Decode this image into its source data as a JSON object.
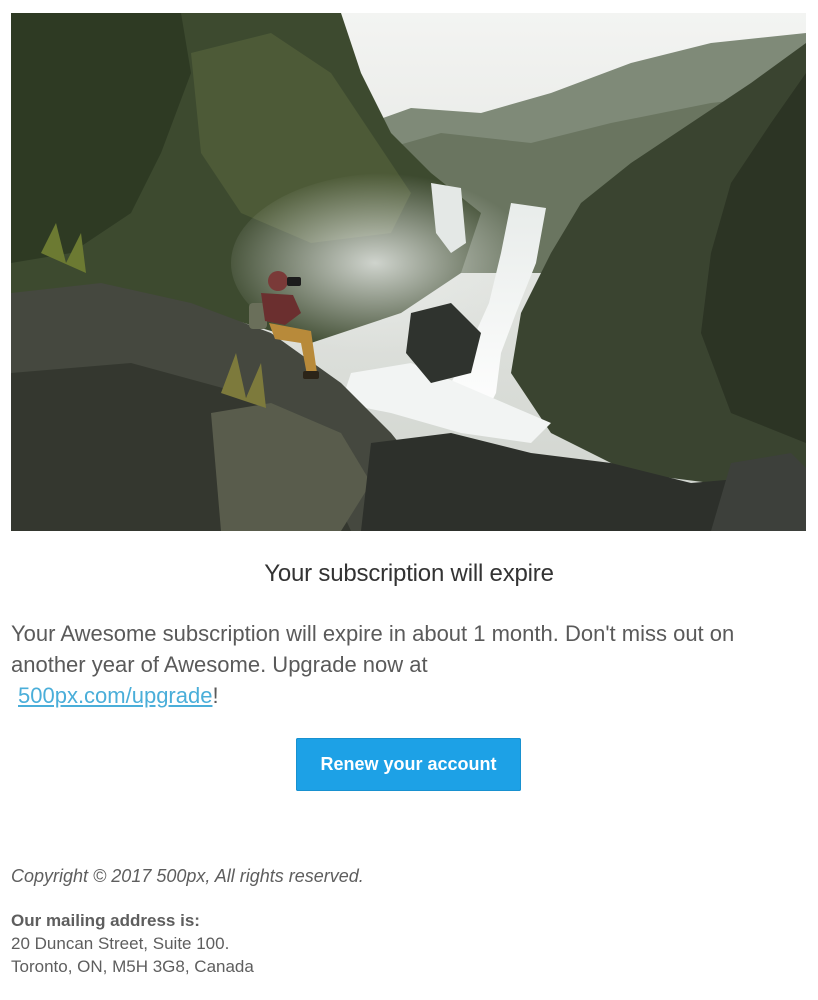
{
  "hero": {
    "alt": "Photographer on rocks beside a waterfall"
  },
  "headline": "Your subscription will expire",
  "message": {
    "text": "Your Awesome subscription will expire in about 1 month. Don't miss out on another year of Awesome. Upgrade now at",
    "link_text": "500px.com/upgrade",
    "suffix": "!"
  },
  "cta": {
    "label": "Renew your account"
  },
  "footer": {
    "copyright": "Copyright © 2017 500px, All rights reserved.",
    "mailing_label": "Our mailing address is:",
    "address_line1": "20 Duncan Street, Suite 100.",
    "address_line2": "Toronto, ON, M5H 3G8, Canada"
  },
  "colors": {
    "accent": "#1da1e6",
    "link": "#4aaed9",
    "text": "#5a5a5a",
    "headline": "#333333"
  }
}
